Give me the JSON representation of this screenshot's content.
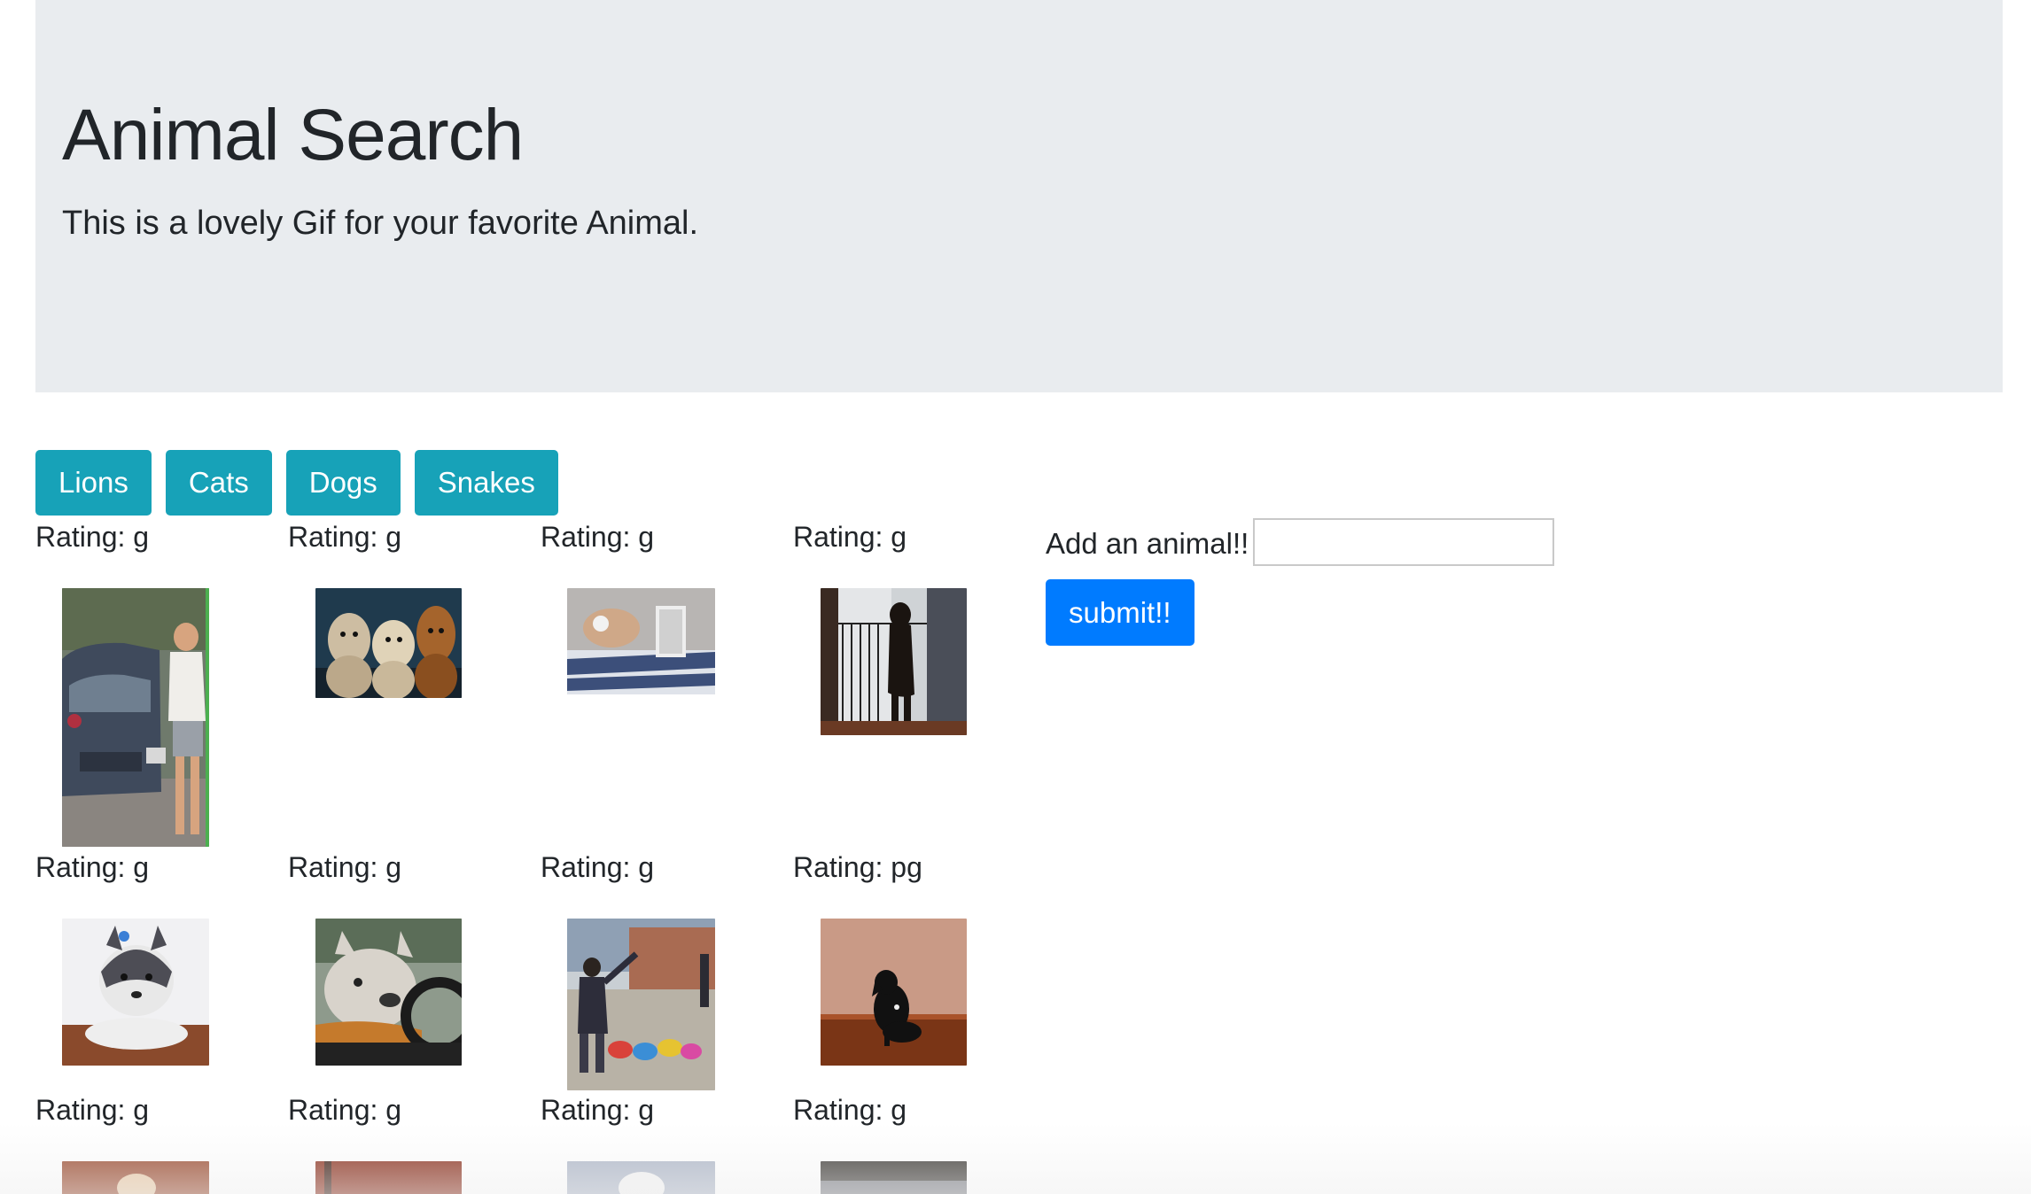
{
  "jumbotron": {
    "title": "Animal Search",
    "lead": "This is a lovely Gif for your favorite Animal."
  },
  "animal_buttons": [
    {
      "label": "Lions"
    },
    {
      "label": "Cats"
    },
    {
      "label": "Dogs"
    },
    {
      "label": "Snakes"
    }
  ],
  "gifs": [
    {
      "rating": "Rating: g",
      "depicts": "woman and dog by blue car"
    },
    {
      "rating": "Rating: g",
      "depicts": "three dogs"
    },
    {
      "rating": "Rating: g",
      "depicts": "dog on bed with laptop"
    },
    {
      "rating": "Rating: g",
      "depicts": "dog standing at balcony door"
    },
    {
      "rating": "Rating: g",
      "depicts": "husky puppy on floor"
    },
    {
      "rating": "Rating: g",
      "depicts": "bulldog driving car"
    },
    {
      "rating": "Rating: g",
      "depicts": "man with puppies in costumes"
    },
    {
      "rating": "Rating: pg",
      "depicts": "small black dog sitting"
    },
    {
      "rating": "Rating: g",
      "depicts": "dog gif"
    },
    {
      "rating": "Rating: g",
      "depicts": "dog gif"
    },
    {
      "rating": "Rating: g",
      "depicts": "fluffy white dog"
    },
    {
      "rating": "Rating: g",
      "depicts": "dog outdoors"
    }
  ],
  "add_form": {
    "label": "Add an animal!!",
    "input_value": "",
    "input_placeholder": "",
    "submit_label": "submit!!"
  },
  "colors": {
    "jumbotron_bg": "#e9ecef",
    "animal_button_bg": "#17a2b8",
    "submit_button_bg": "#007bff",
    "text": "#212529"
  }
}
